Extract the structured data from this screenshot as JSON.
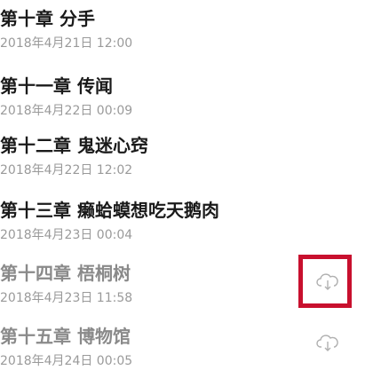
{
  "chapters": [
    {
      "title": "第十章 分手",
      "date": "2018年4月21日 12:00",
      "downloaded": true
    },
    {
      "title": "第十一章 传闻",
      "date": "2018年4月22日 00:09",
      "downloaded": true
    },
    {
      "title": "第十二章 鬼迷心窍",
      "date": "2018年4月22日 12:02",
      "downloaded": true
    },
    {
      "title": "第十三章 癞蛤蟆想吃天鹅肉",
      "date": "2018年4月23日 00:04",
      "downloaded": true
    },
    {
      "title": "第十四章 梧桐树",
      "date": "2018年4月23日 11:58",
      "downloaded": false
    },
    {
      "title": "第十五章 博物馆",
      "date": "2018年4月24日 00:05",
      "downloaded": false
    }
  ],
  "icons": {
    "download": "cloud-download-icon"
  },
  "colors": {
    "highlight": "#c8102e",
    "title": "#1a1a1a",
    "muted": "#8a8a8a",
    "date": "#9a9a9a"
  }
}
